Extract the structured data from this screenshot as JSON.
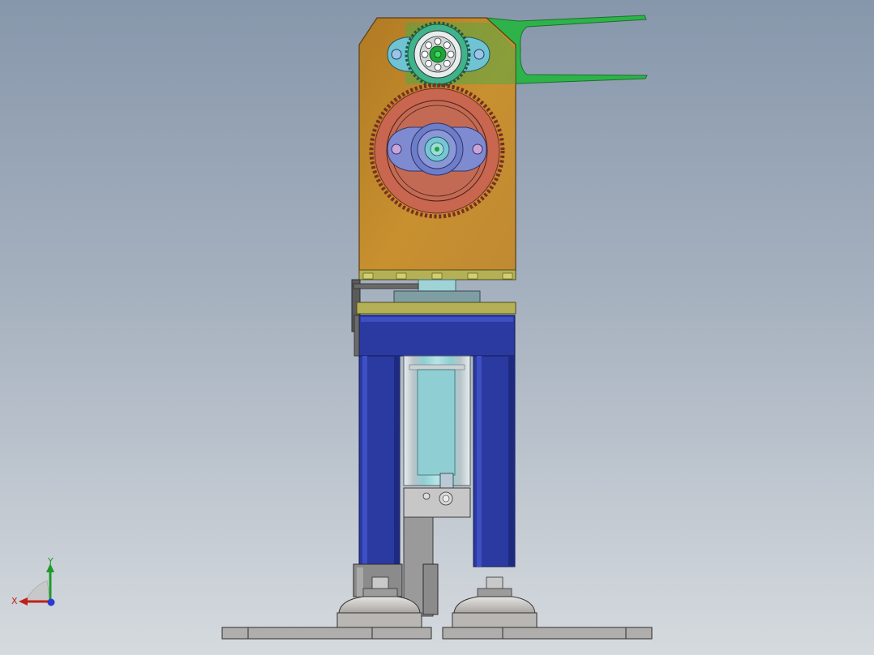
{
  "view": {
    "background_top": "#8797ab",
    "background_bottom": "#d5dade"
  },
  "model": {
    "colors": {
      "housing": "#c48a2e",
      "housing_dark": "#9c6b22",
      "gear_large": "#c8664f",
      "gear_small": "#2fa07a",
      "bearing_blue": "#7b88c8",
      "bearing_cyan": "#57b8c8",
      "gripper_green": "#2db34a",
      "column_blue": "#2b3aa0",
      "plate_olive": "#b4b055",
      "cylinder_cyan": "#9fd3d6",
      "metal_grey": "#a8a8a8",
      "foot_grey": "#c9c7c4"
    }
  },
  "triad": {
    "x_label": "X",
    "y_label": "Y",
    "icon": "coordinate-triad-icon"
  }
}
